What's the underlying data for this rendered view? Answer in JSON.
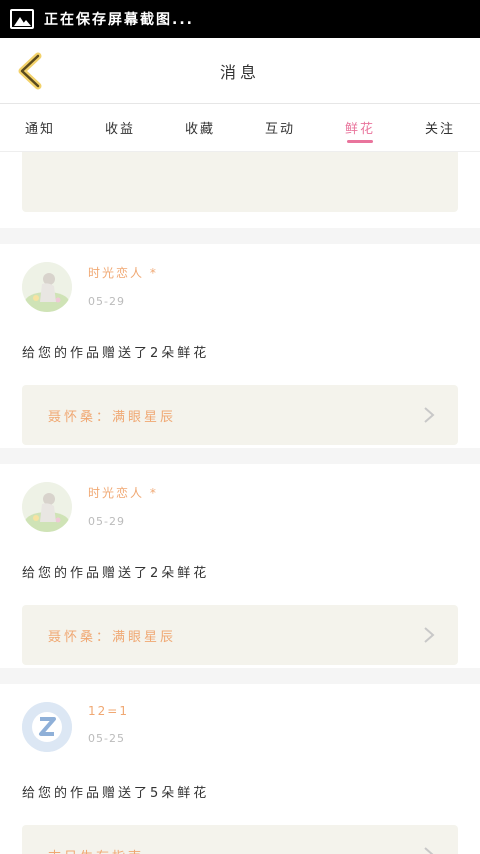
{
  "status_bar": {
    "text": "正在保存屏幕截图..."
  },
  "header": {
    "title": "消息"
  },
  "tabs": [
    {
      "label": "通知"
    },
    {
      "label": "收益"
    },
    {
      "label": "收藏"
    },
    {
      "label": "互动"
    },
    {
      "label": "鲜花"
    },
    {
      "label": "关注"
    }
  ],
  "active_tab": "鲜花",
  "notifications": [
    {
      "user": "时光恋人 *",
      "date": "05-29",
      "message": "给您的作品赠送了2朵鲜花",
      "work": "聂怀桑：满眼星辰"
    },
    {
      "user": "时光恋人 *",
      "date": "05-29",
      "message": "给您的作品赠送了2朵鲜花",
      "work": "聂怀桑：满眼星辰"
    },
    {
      "user": "12=1",
      "date": "05-25",
      "message": "给您的作品赠送了5朵鲜花",
      "work": "末日生存指南"
    }
  ],
  "colors": {
    "accent": "#e9749c",
    "username": "#f0a873",
    "work_box_bg": "#f4f3ec"
  }
}
